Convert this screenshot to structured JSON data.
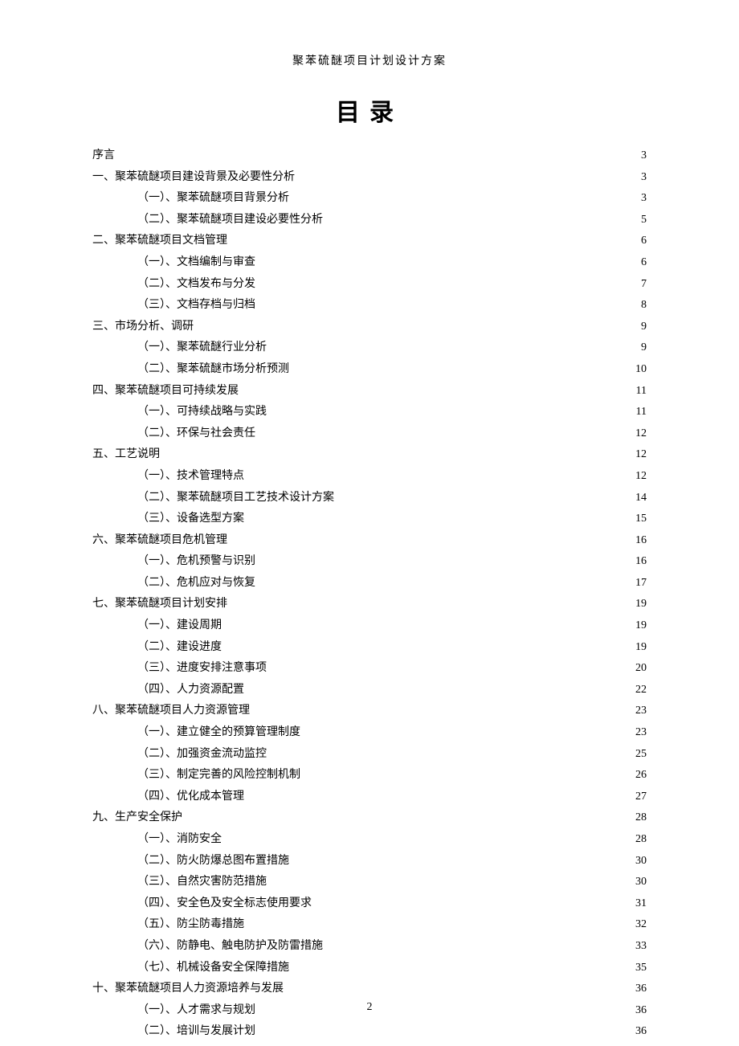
{
  "header": "聚苯硫醚项目计划设计方案",
  "title": "目录",
  "page_number": "2",
  "toc": [
    {
      "level": 1,
      "label": "序言",
      "page": "3"
    },
    {
      "level": 1,
      "label": "一、聚苯硫醚项目建设背景及必要性分析",
      "page": "3"
    },
    {
      "level": 2,
      "label": "（一）、聚苯硫醚项目背景分析",
      "page": "3"
    },
    {
      "level": 2,
      "label": "（二）、聚苯硫醚项目建设必要性分析",
      "page": "5"
    },
    {
      "level": 1,
      "label": "二、聚苯硫醚项目文档管理",
      "page": "6"
    },
    {
      "level": 2,
      "label": "（一）、文档编制与审查",
      "page": "6"
    },
    {
      "level": 2,
      "label": "（二）、文档发布与分发",
      "page": "7"
    },
    {
      "level": 2,
      "label": "（三）、文档存档与归档",
      "page": "8"
    },
    {
      "level": 1,
      "label": "三、市场分析、调研",
      "page": "9"
    },
    {
      "level": 2,
      "label": "（一）、聚苯硫醚行业分析",
      "page": "9"
    },
    {
      "level": 2,
      "label": "（二）、聚苯硫醚市场分析预测",
      "page": "10"
    },
    {
      "level": 1,
      "label": "四、聚苯硫醚项目可持续发展",
      "page": "11"
    },
    {
      "level": 2,
      "label": "（一）、可持续战略与实践",
      "page": "11"
    },
    {
      "level": 2,
      "label": "（二）、环保与社会责任",
      "page": "12"
    },
    {
      "level": 1,
      "label": "五、工艺说明",
      "page": "12"
    },
    {
      "level": 2,
      "label": "（一）、技术管理特点",
      "page": "12"
    },
    {
      "level": 2,
      "label": "（二）、聚苯硫醚项目工艺技术设计方案",
      "page": "14"
    },
    {
      "level": 2,
      "label": "（三）、设备选型方案",
      "page": "15"
    },
    {
      "level": 1,
      "label": "六、聚苯硫醚项目危机管理",
      "page": "16"
    },
    {
      "level": 2,
      "label": "（一）、危机预警与识别",
      "page": "16"
    },
    {
      "level": 2,
      "label": "（二）、危机应对与恢复",
      "page": "17"
    },
    {
      "level": 1,
      "label": "七、聚苯硫醚项目计划安排",
      "page": "19"
    },
    {
      "level": 2,
      "label": "（一）、建设周期",
      "page": "19"
    },
    {
      "level": 2,
      "label": "（二）、建设进度",
      "page": "19"
    },
    {
      "level": 2,
      "label": "（三）、进度安排注意事项",
      "page": "20"
    },
    {
      "level": 2,
      "label": "（四）、人力资源配置",
      "page": "22"
    },
    {
      "level": 1,
      "label": "八、聚苯硫醚项目人力资源管理",
      "page": "23"
    },
    {
      "level": 2,
      "label": "（一）、建立健全的预算管理制度",
      "page": "23"
    },
    {
      "level": 2,
      "label": "（二）、加强资金流动监控",
      "page": "25"
    },
    {
      "level": 2,
      "label": "（三）、制定完善的风险控制机制",
      "page": "26"
    },
    {
      "level": 2,
      "label": "（四）、优化成本管理",
      "page": "27"
    },
    {
      "level": 1,
      "label": "九、生产安全保护",
      "page": "28"
    },
    {
      "level": 2,
      "label": "（一）、消防安全",
      "page": "28"
    },
    {
      "level": 2,
      "label": "（二）、防火防爆总图布置措施",
      "page": "30"
    },
    {
      "level": 2,
      "label": "（三）、自然灾害防范措施",
      "page": "30"
    },
    {
      "level": 2,
      "label": "（四）、安全色及安全标志使用要求",
      "page": "31"
    },
    {
      "level": 2,
      "label": "（五）、防尘防毒措施",
      "page": "32"
    },
    {
      "level": 2,
      "label": "（六）、防静电、触电防护及防雷措施",
      "page": "33"
    },
    {
      "level": 2,
      "label": "（七）、机械设备安全保障措施",
      "page": "35"
    },
    {
      "level": 1,
      "label": "十、聚苯硫醚项目人力资源培养与发展",
      "page": "36"
    },
    {
      "level": 2,
      "label": "（一）、人才需求与规划",
      "page": "36"
    },
    {
      "level": 2,
      "label": "（二）、培训与发展计划",
      "page": "36"
    }
  ]
}
